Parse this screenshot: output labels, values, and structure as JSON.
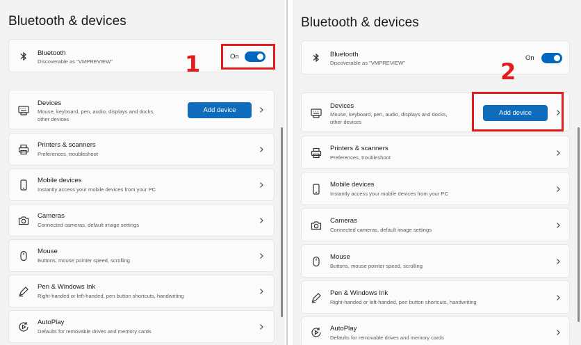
{
  "page": {
    "title": "Bluetooth & devices"
  },
  "bluetooth": {
    "title": "Bluetooth",
    "description": "Discoverable as \"VMPREVIEW\"",
    "toggle_label": "On",
    "toggle_on": true
  },
  "devices": {
    "title": "Devices",
    "description_line1": "Mouse, keyboard, pen, audio, displays and docks,",
    "description_line2": "other devices",
    "add_button": "Add device"
  },
  "items": [
    {
      "title": "Printers & scanners",
      "description": "Preferences, troubleshoot",
      "icon": "printer-icon"
    },
    {
      "title": "Mobile devices",
      "description": "Instantly access your mobile devices from your PC",
      "icon": "phone-icon"
    },
    {
      "title": "Cameras",
      "description": "Connected cameras, default image settings",
      "icon": "camera-icon"
    },
    {
      "title": "Mouse",
      "description": "Buttons, mouse pointer speed, scrolling",
      "icon": "mouse-icon"
    },
    {
      "title": "Pen & Windows Ink",
      "description": "Right-handed or left-handed, pen button shortcuts, handwriting",
      "icon": "pen-icon"
    },
    {
      "title": "AutoPlay",
      "description": "Defaults for removable drives and memory cards",
      "icon": "autoplay-icon"
    }
  ],
  "annotations": {
    "step1": "1",
    "step2": "2",
    "color": "#e21c1c"
  },
  "accent_color": "#0f6cbd"
}
